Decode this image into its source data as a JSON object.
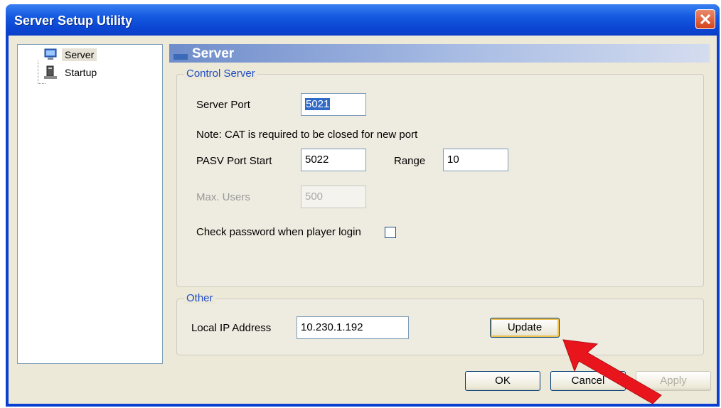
{
  "window": {
    "title": "Server Setup Utility"
  },
  "tree": {
    "items": [
      {
        "label": "Server",
        "icon": "monitor-icon",
        "selected": true
      },
      {
        "label": "Startup",
        "icon": "computer-icon",
        "selected": false
      }
    ]
  },
  "panel": {
    "title": "Server"
  },
  "control_server": {
    "legend": "Control Server",
    "server_port_label": "Server Port",
    "server_port_value": "5021",
    "note": "Note: CAT is required to be closed  for new port",
    "pasv_port_start_label": "PASV Port Start",
    "pasv_port_start_value": "5022",
    "range_label": "Range",
    "range_value": "10",
    "max_users_label": "Max. Users",
    "max_users_value": "500",
    "check_password_label": "Check password when player login",
    "check_password_checked": false
  },
  "other": {
    "legend": "Other",
    "local_ip_label": "Local IP Address",
    "local_ip_value": "10.230.1.192",
    "update_label": "Update"
  },
  "buttons": {
    "ok": "OK",
    "cancel": "Cancel",
    "apply": "Apply"
  },
  "colors": {
    "titlebar": "#0b46d3",
    "legend_text": "#1e4bc6",
    "annotation_arrow": "#e8161c"
  }
}
